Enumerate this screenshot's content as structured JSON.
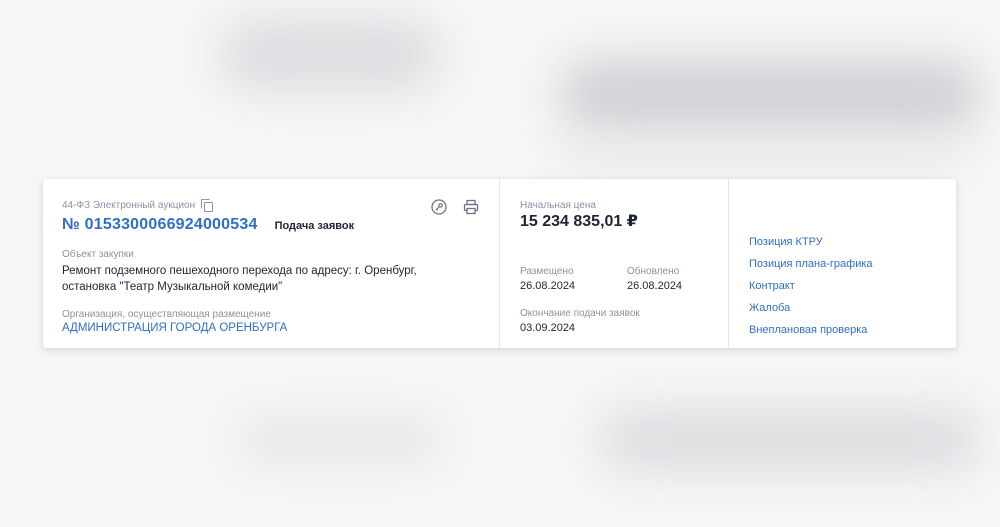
{
  "card": {
    "procurement_type": "44-ФЗ Электронный аукцион",
    "number": "№ 0153300066924000534",
    "status": "Подача заявок",
    "object_label": "Объект закупки",
    "object_text": "Ремонт подземного пешеходного перехода по адресу: г. Оренбург, остановка \"Театр Музыкальной комедии\"",
    "org_label": "Организация, осуществляющая размещение",
    "org_name": "АДМИНИСТРАЦИЯ ГОРОДА ОРЕНБУРГА",
    "icons": {
      "copy": "copy-icon",
      "key": "key-icon",
      "print": "printer-icon"
    }
  },
  "price": {
    "label": "Начальная цена",
    "value": "15 234 835,01 ₽",
    "published_label": "Размещено",
    "published_value": "26.08.2024",
    "updated_label": "Обновлено",
    "updated_value": "26.08.2024",
    "end_label": "Окончание подачи заявок",
    "end_value": "03.09.2024"
  },
  "links": [
    "Позиция КТРУ",
    "Позиция плана-графика",
    "Контракт",
    "Жалоба",
    "Внеплановая проверка"
  ],
  "colors": {
    "accent": "#2f6fc4",
    "text": "#1d2433",
    "muted": "#8a93a2"
  }
}
